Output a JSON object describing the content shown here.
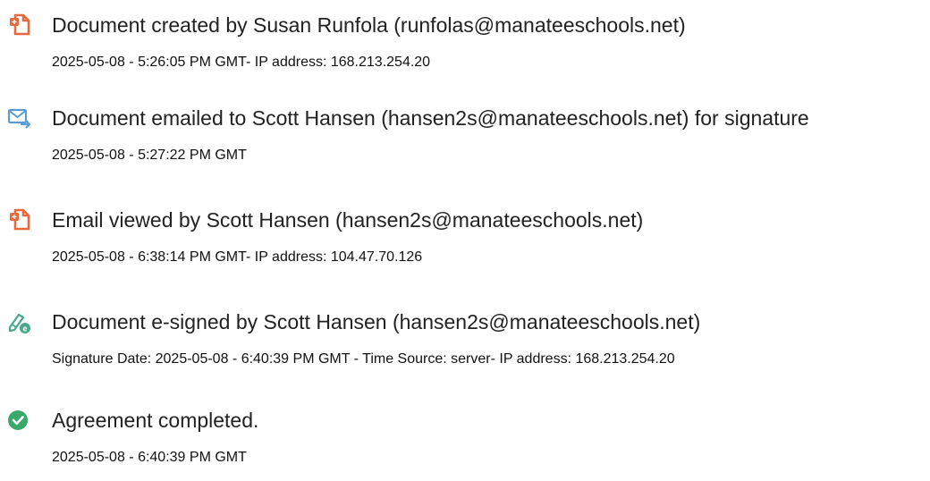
{
  "colors": {
    "doc_icon": "#e8693e",
    "email_icon": "#5b9bd5",
    "sign_icon": "#4aa88a",
    "complete_icon": "#3aa86b"
  },
  "events": [
    {
      "icon": "document-created-icon",
      "title": "Document created by Susan Runfola (runfolas@manateeschools.net)",
      "detail": "2025-05-08 - 5:26:05 PM GMT- IP address: 168.213.254.20"
    },
    {
      "icon": "email-sent-icon",
      "title": "Document emailed to Scott Hansen (hansen2s@manateeschools.net) for signature",
      "detail": "2025-05-08 - 5:27:22 PM GMT"
    },
    {
      "icon": "email-viewed-icon",
      "title": "Email viewed by Scott Hansen (hansen2s@manateeschools.net)",
      "detail": "2025-05-08 - 6:38:14 PM GMT- IP address: 104.47.70.126"
    },
    {
      "icon": "e-signature-icon",
      "title": "Document e-signed by Scott Hansen (hansen2s@manateeschools.net)",
      "detail": "Signature Date: 2025-05-08 - 6:40:39 PM GMT - Time Source: server- IP address: 168.213.254.20"
    },
    {
      "icon": "check-circle-icon",
      "title": "Agreement completed.",
      "detail": "2025-05-08 - 6:40:39 PM GMT"
    }
  ]
}
